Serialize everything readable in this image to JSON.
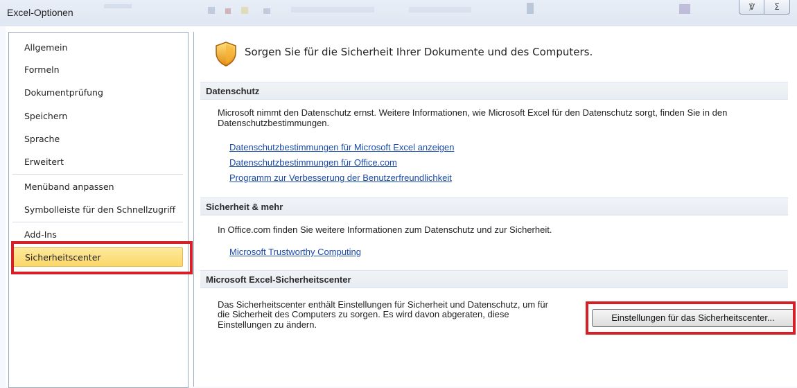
{
  "window": {
    "title": "Excel-Optionen",
    "help_icon": "pin-icon",
    "close_icon": "close-icon",
    "help_glyph": "℣",
    "close_glyph": "Σ"
  },
  "nav": {
    "items": [
      {
        "label": "Allgemein",
        "selected": false
      },
      {
        "label": "Formeln",
        "selected": false
      },
      {
        "label": "Dokumentprüfung",
        "selected": false
      },
      {
        "label": "Speichern",
        "selected": false
      },
      {
        "label": "Sprache",
        "selected": false
      },
      {
        "label": "Erweitert",
        "selected": false
      },
      {
        "label": "Menüband anpassen",
        "selected": false
      },
      {
        "label": "Symbolleiste für den Schnellzugriff",
        "selected": false
      },
      {
        "label": "Add-Ins",
        "selected": false
      },
      {
        "label": "Sicherheitscenter",
        "selected": true
      }
    ]
  },
  "content": {
    "heading": "Sorgen Sie für die Sicherheit Ihrer Dokumente und des Computers.",
    "heading_icon": "shield-icon",
    "sections": {
      "privacy": {
        "title": "Datenschutz",
        "text_line1": "Microsoft nimmt den Datenschutz ernst. Weitere Informationen, wie Microsoft Excel für den Datenschutz sorgt, finden Sie in den",
        "text_line2": "Datenschutzbestimmungen.",
        "links": [
          "Datenschutzbestimmungen für Microsoft Excel anzeigen",
          "Datenschutzbestimmungen für Office.com",
          "Programm zur Verbesserung der Benutzerfreundlichkeit"
        ]
      },
      "security": {
        "title": "Sicherheit & mehr",
        "text": "In Office.com finden Sie weitere Informationen zum Datenschutz und zur Sicherheit.",
        "link": "Microsoft Trustworthy Computing"
      },
      "trust_center": {
        "title": "Microsoft Excel-Sicherheitscenter",
        "text_line1": "Das Sicherheitscenter enthält Einstellungen für Sicherheit und Datenschutz, um für",
        "text_line2": "die Sicherheit des Computers zu sorgen. Es wird davon abgeraten, diese",
        "text_line3": "Einstellungen zu ändern.",
        "button_label": "Einstellungen für das Sicherheitscenter..."
      }
    }
  },
  "colors": {
    "highlight": "#d52027",
    "link": "#1a4aa8",
    "selected_nav": "#fbd768"
  }
}
